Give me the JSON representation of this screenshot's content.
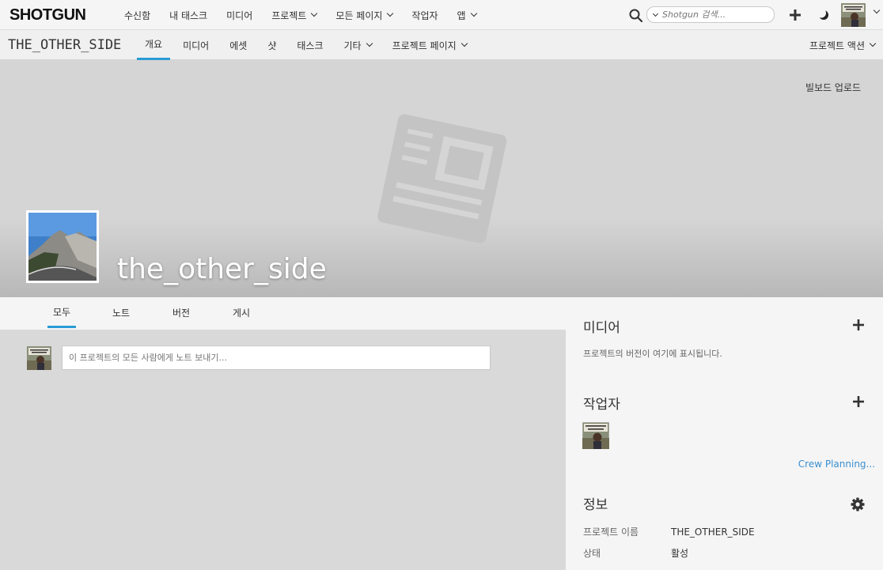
{
  "app": {
    "logo": "SHOTGUN"
  },
  "topnav": {
    "items": [
      {
        "label": "수신함",
        "dropdown": false
      },
      {
        "label": "내 태스크",
        "dropdown": false
      },
      {
        "label": "미디어",
        "dropdown": false
      },
      {
        "label": "프로젝트",
        "dropdown": true
      },
      {
        "label": "모든 페이지",
        "dropdown": true
      },
      {
        "label": "작업자",
        "dropdown": false
      },
      {
        "label": "앱",
        "dropdown": true
      }
    ],
    "search_placeholder": "Shotgun 검색..."
  },
  "project": {
    "name": "THE_OTHER_SIDE",
    "tabs": [
      {
        "label": "개요",
        "active": true
      },
      {
        "label": "미디어",
        "active": false
      },
      {
        "label": "에셋",
        "active": false
      },
      {
        "label": "샷",
        "active": false
      },
      {
        "label": "태스크",
        "active": false
      },
      {
        "label": "기타",
        "active": false,
        "dropdown": true
      },
      {
        "label": "프로젝트 페이지",
        "active": false,
        "dropdown": true
      }
    ],
    "actions_label": "프로젝트 액션"
  },
  "hero": {
    "billboard_upload": "빌보드 업로드",
    "title": "the_other_side"
  },
  "feed": {
    "tabs": [
      "모두",
      "노트",
      "버전",
      "게시"
    ],
    "active_tab": "모두",
    "note_placeholder": "이 프로젝트의 모든 사람에게 노트 보내기..."
  },
  "side": {
    "media": {
      "title": "미디어",
      "hint": "프로젝트의 버전이 여기에 표시됩니다."
    },
    "people": {
      "title": "작업자",
      "link": "Crew Planning..."
    },
    "info": {
      "title": "정보",
      "rows": [
        {
          "key": "프로젝트 이름",
          "value": "THE_OTHER_SIDE"
        },
        {
          "key": "상태",
          "value": "활성"
        }
      ]
    }
  },
  "colors": {
    "accent": "#2a9bd6",
    "link": "#3a8fd0"
  }
}
